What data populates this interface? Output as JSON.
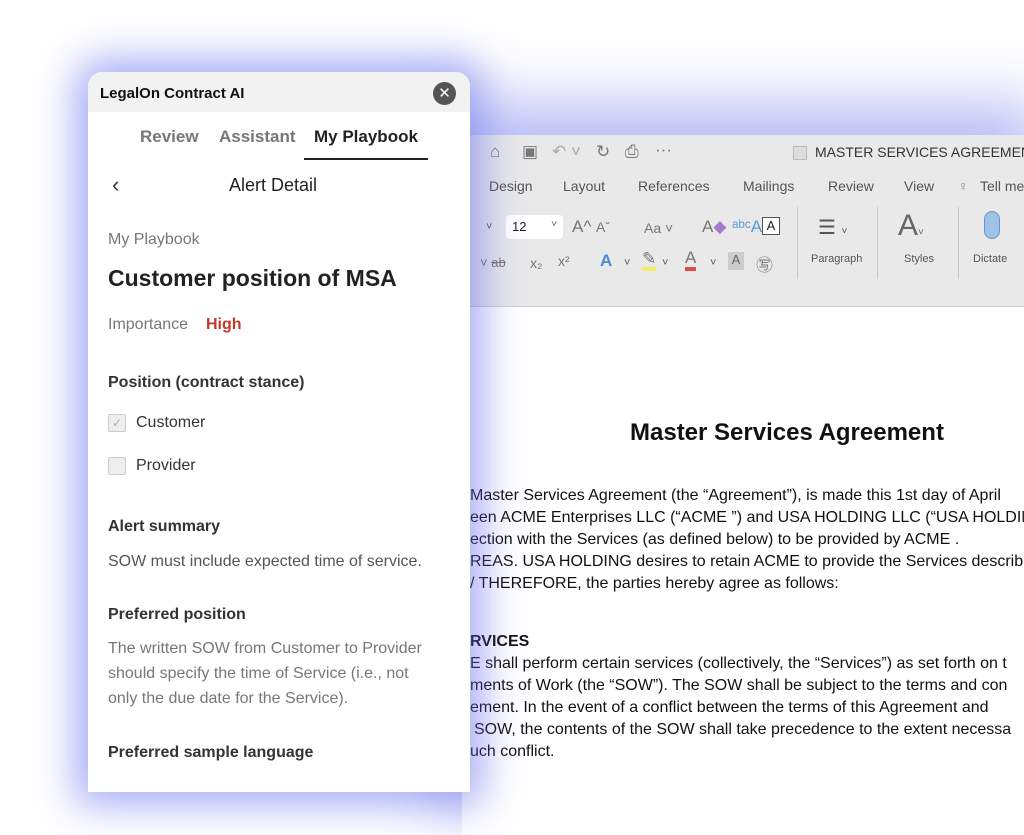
{
  "word": {
    "doc_title": "MASTER SERVICES AGREEMENT",
    "ribbon_tabs": [
      "Design",
      "Layout",
      "References",
      "Mailings",
      "Review",
      "View",
      "Tell me"
    ],
    "font_size": "12",
    "groups": {
      "paragraph": "Paragraph",
      "styles": "Styles",
      "dictate": "Dictate"
    },
    "document": {
      "heading": "Master Services Agreement",
      "intro_lines": [
        "Master Services Agreement (the “Agreement”), is made this 1st day of April",
        "een ACME Enterprises LLC (“ACME ”) and USA HOLDING LLC (“USA HOLDING",
        "ection with the Services (as defined below) to be provided by ACME .",
        "REAS. USA HOLDING desires to retain ACME to provide the Services describ",
        "/ THEREFORE, the parties hereby agree as follows:"
      ],
      "section_heading": "RVICES",
      "section_lines": [
        "E shall perform certain services (collectively, the “Services”) as set forth on t",
        "ments of Work (the “SOW”). The SOW shall be subject to the terms and con",
        "ement. In the event of a conflict between the terms of this Agreement and",
        "SOW, the contents of the SOW shall take precedence to the extent necessa",
        "uch conflict."
      ]
    }
  },
  "panel": {
    "title": "LegalOn Contract AI",
    "tabs": [
      "Review",
      "Assistant",
      "My Playbook"
    ],
    "active_tab": "My Playbook",
    "nav_title": "Alert Detail",
    "breadcrumb": "My Playbook",
    "alert_title": "Customer position of MSA",
    "importance_label": "Importance",
    "importance_value": "High",
    "importance_color": "#c0392b",
    "position_heading": "Position (contract stance)",
    "options": [
      {
        "label": "Customer",
        "checked": true
      },
      {
        "label": "Provider",
        "checked": false
      }
    ],
    "summary_heading": "Alert summary",
    "summary_text": "SOW must include expected time of service.",
    "preferred_heading": "Preferred position",
    "preferred_lines": [
      "The written SOW from Customer to Provider",
      "should specify the time of Service (i.e., not",
      "only the due date for the Service)."
    ],
    "sample_heading": "Preferred sample language"
  }
}
